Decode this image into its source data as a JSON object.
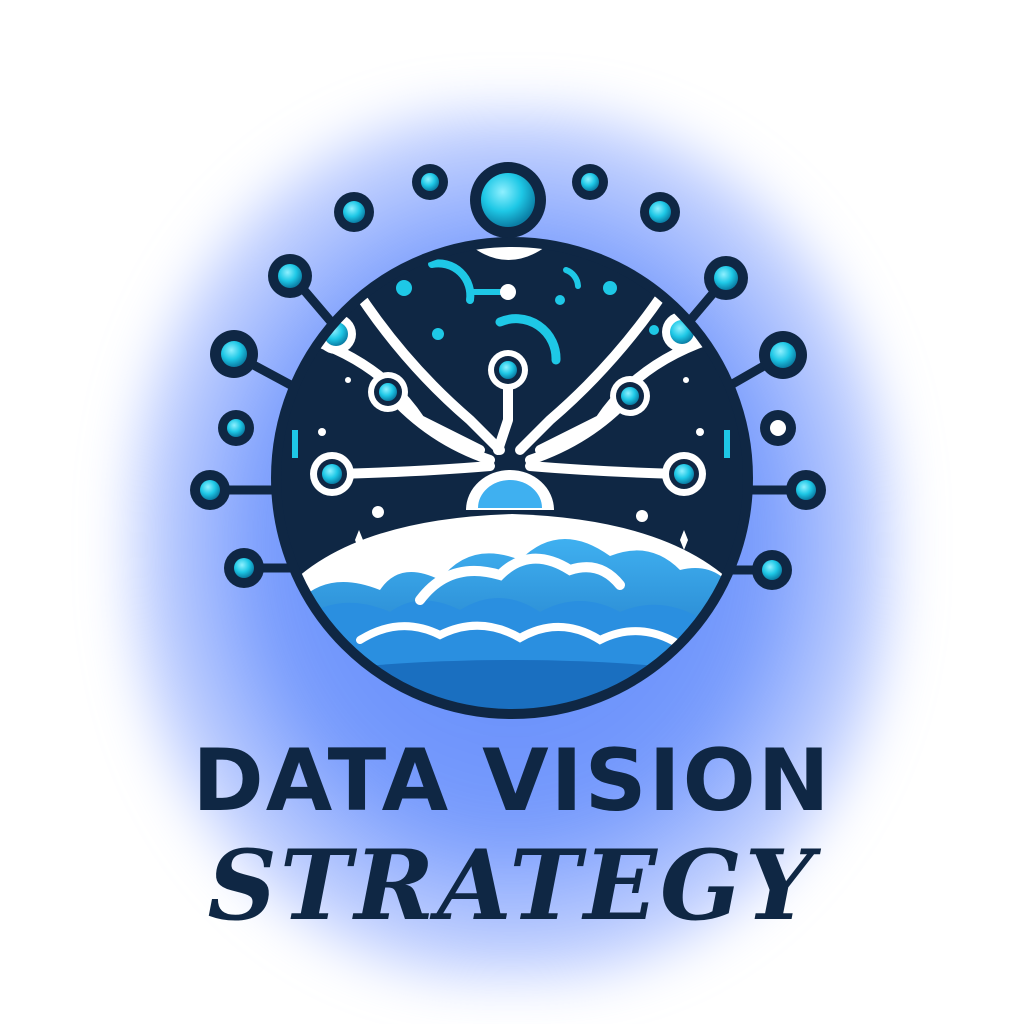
{
  "logo": {
    "title_line1": "DATA VISION",
    "title_line2": "STRATEGY",
    "icon_name": "data-network-globe-icon"
  },
  "colors": {
    "glow": "#5c86fa",
    "navy": "#0f2744",
    "cyan": "#1ec8e6",
    "cloud_blue": "#2a8fe0",
    "white": "#ffffff"
  }
}
